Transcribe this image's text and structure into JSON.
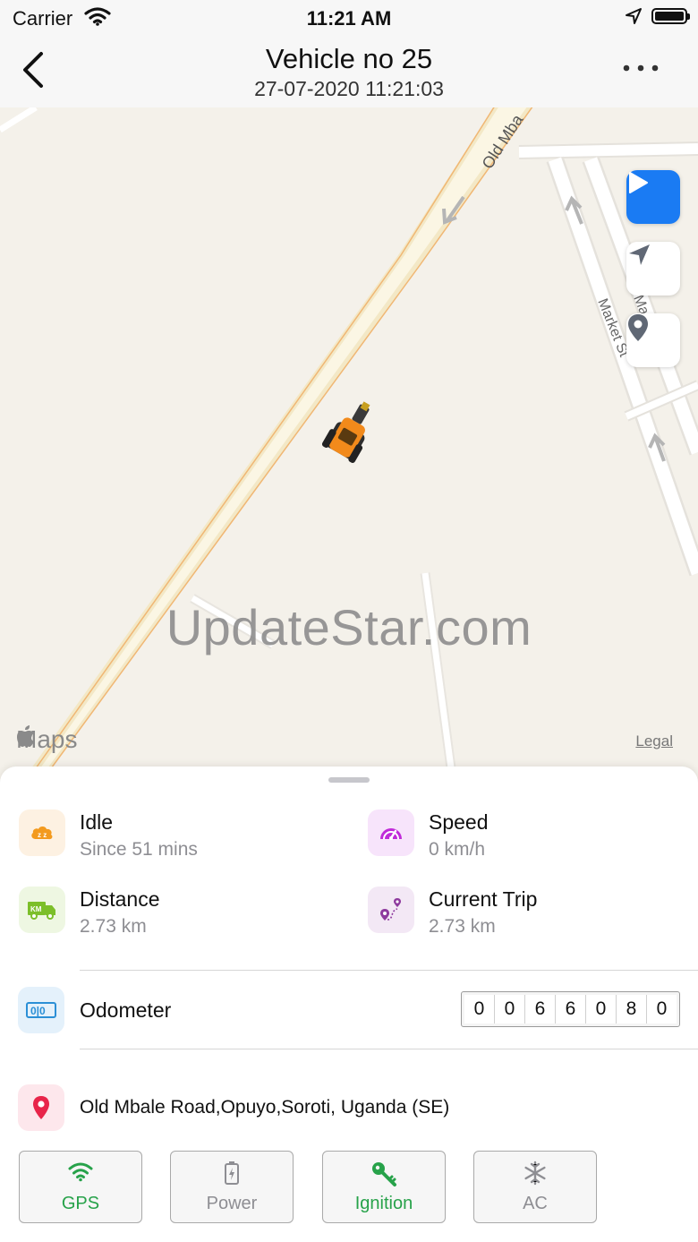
{
  "status_bar": {
    "carrier": "Carrier",
    "time": "11:21 AM"
  },
  "header": {
    "title": "Vehicle no 25",
    "subtitle": "27-07-2020 11:21:03"
  },
  "map": {
    "road_labels": {
      "old_mbale": "Old Mba",
      "market_st": "Market St",
      "market_st_2": "Ma"
    },
    "watermark": "UpdateStar.com",
    "attribution": "Maps",
    "legal": "Legal",
    "play_color": "#1a7bf3",
    "vehicle_color": "#f28a1b"
  },
  "stats": {
    "idle": {
      "label": "Idle",
      "value": "Since 51 mins",
      "icon": "idle-cloud-icon",
      "color": "#f39a1e"
    },
    "speed": {
      "label": "Speed",
      "value": "0 km/h",
      "icon": "speedometer-icon",
      "color": "#c02bd9"
    },
    "distance": {
      "label": "Distance",
      "value": "2.73 km",
      "icon": "delivery-truck-icon",
      "color": "#7cbf2a"
    },
    "current_trip": {
      "label": "Current Trip",
      "value": "2.73 km",
      "icon": "route-icon",
      "color": "#8e3a9e"
    }
  },
  "odometer": {
    "label": "Odometer",
    "digits": [
      "0",
      "0",
      "6",
      "6",
      "0",
      "8",
      "0"
    ],
    "icon_text": "0|0"
  },
  "address": {
    "text": "Old Mbale Road,Opuyo,Soroti, Uganda (SE)",
    "icon": "map-pin-icon",
    "color": "#e8254a"
  },
  "status_buttons": [
    {
      "label": "GPS",
      "state": "on",
      "icon": "wifi-signal-icon"
    },
    {
      "label": "Power",
      "state": "off",
      "icon": "battery-icon"
    },
    {
      "label": "Ignition",
      "state": "on",
      "icon": "key-icon"
    },
    {
      "label": "AC",
      "state": "off",
      "icon": "snowflake-icon"
    }
  ],
  "colors": {
    "active_green": "#27a24a",
    "inactive_gray": "#8e8e93"
  }
}
